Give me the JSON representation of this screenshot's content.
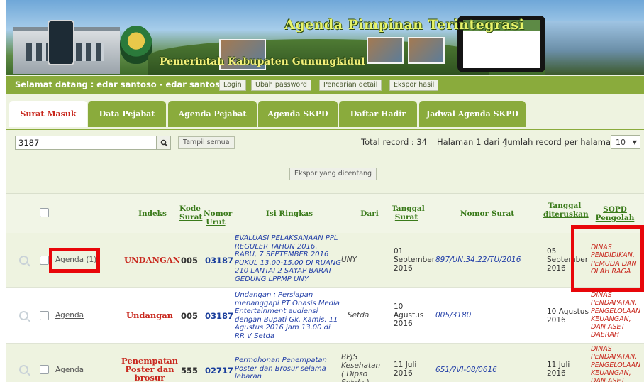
{
  "header": {
    "app_title": "Agenda Pimpinan Terintegrasi",
    "app_subtitle": "Pemerintah Kabupaten Gunungkidul"
  },
  "welcome": {
    "text": "Selamat datang : edar santoso - edar santoso",
    "buttons": [
      "Login",
      "Ubah password",
      "Pencarian detail",
      "Ekspor hasil"
    ]
  },
  "tabs": [
    {
      "label": "Surat Masuk",
      "active": true
    },
    {
      "label": "Data Pejabat",
      "active": false
    },
    {
      "label": "Agenda Pejabat",
      "active": false
    },
    {
      "label": "Agenda SKPD",
      "active": false
    },
    {
      "label": "Daftar Hadir",
      "active": false
    },
    {
      "label": "Jadwal Agenda SKPD",
      "active": false
    }
  ],
  "search": {
    "value": "3187",
    "show_all_label": "Tampil semua"
  },
  "summary": {
    "total_record": "Total record : 34",
    "page_info": "Halaman 1 dari 4",
    "per_page_label": "Jumlah record per halaman:",
    "per_page_value": "10"
  },
  "export_selected_label": "Ekspor yang dicentang",
  "columns": {
    "indeks": "Indeks",
    "kode_surat": "Kode Surat",
    "nomor_urut": "Nomor Urut",
    "isi_ringkas": "Isi Ringkas",
    "dari": "Dari",
    "tanggal_surat": "Tanggal Surat",
    "nomor_surat": "Nomor Surat",
    "tanggal_diteruskan": "Tanggal diteruskan",
    "sopd_pengolah": "SOPD Pengolah"
  },
  "rows": [
    {
      "agenda": "Agenda (1)",
      "indeks": "UNDANGAN",
      "kode": "005",
      "nomor_urut": "03187",
      "isi_ringkas": "EVALUASI PELAKSANAAN PPL REGULER TAHUN 2016. RABU, 7 SEPTEMBER 2016 PUKUL 13.00-15.00 DI RUANG 210 LANTAI 2 SAYAP BARAT GEDUNG LPPMP UNY",
      "dari": "UNY",
      "tanggal_surat": "01 September 2016",
      "nomor_surat": "897/UN.34.22/TU/2016",
      "tanggal_diteruskan": "05 September 2016",
      "sopd": "DINAS PENDIDIKAN, PEMUDA DAN OLAH RAGA"
    },
    {
      "agenda": "Agenda",
      "indeks": "Undangan",
      "kode": "005",
      "nomor_urut": "03187",
      "isi_ringkas": "Undangan : Persiapan menanggapi PT Onasis Media Entertainment audiensi dengan Bupati Gk. Kamis, 11 Agustus 2016 jam 13.00 di RR V Setda",
      "dari": "Setda",
      "tanggal_surat": "10 Agustus 2016",
      "nomor_surat": "005/3180",
      "tanggal_diteruskan": "10 Agustus 2016",
      "sopd": "DINAS PENDAPATAN, PENGELOLAAN KEUANGAN, DAN ASET DAERAH"
    },
    {
      "agenda": "Agenda",
      "indeks": "Penempatan Poster dan brosur",
      "kode": "555",
      "nomor_urut": "02717",
      "isi_ringkas": "Permohonan Penempatan Poster dan Brosur selama lebaran",
      "dari": "BPJS Kesehatan ( Dipso Sekda )",
      "tanggal_surat": "11 Juli 2016",
      "nomor_surat": "651/?VI-08/0616",
      "tanggal_diteruskan": "11 Juli 2016",
      "sopd": "DINAS PENDAPATAN, PENGELOLAAN KEUANGAN, DAN ASET DAERAH"
    }
  ]
}
